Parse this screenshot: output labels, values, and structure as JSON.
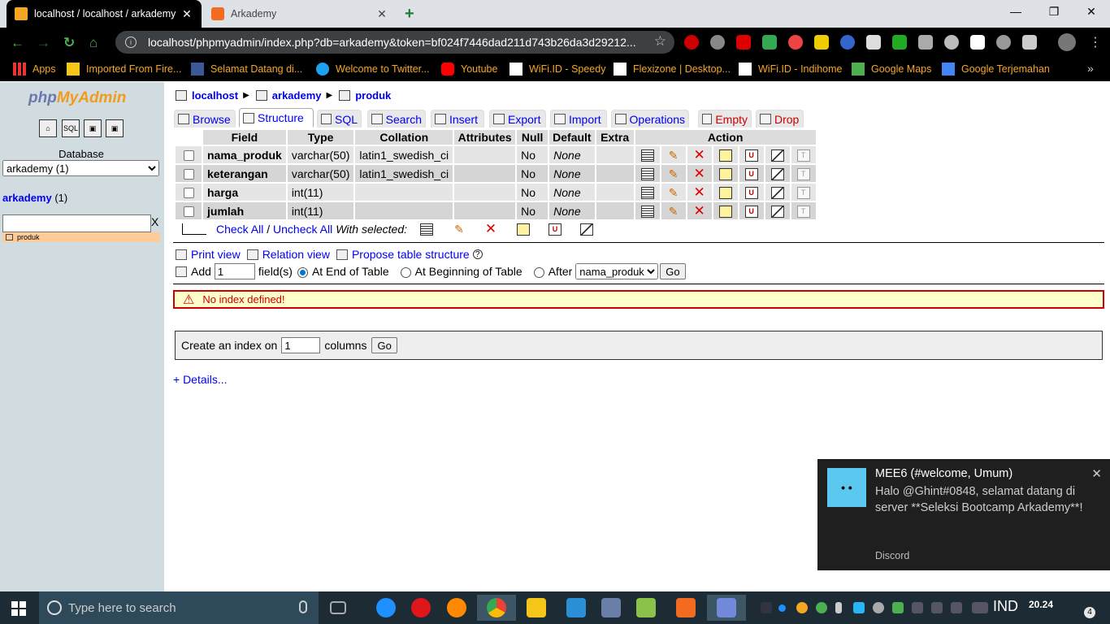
{
  "browser": {
    "tabs": [
      {
        "title": "localhost / localhost / arkademy",
        "active": true
      },
      {
        "title": "Arkademy",
        "active": false
      }
    ],
    "url": "localhost/phpmyadmin/index.php?db=arkademy&token=bf024f7446dad211d743b26da3d29212...",
    "bookmarks": [
      {
        "label": "Apps",
        "icon": "apps-grid-icon"
      },
      {
        "label": "Imported From Fire...",
        "icon": "folder-icon"
      },
      {
        "label": "Selamat Datang di...",
        "icon": "facebook-icon"
      },
      {
        "label": "Welcome to Twitter...",
        "icon": "twitter-icon"
      },
      {
        "label": "Youtube",
        "icon": "youtube-icon"
      },
      {
        "label": "WiFi.ID - Speedy",
        "icon": "page-icon"
      },
      {
        "label": "Flexizone | Desktop...",
        "icon": "page-icon"
      },
      {
        "label": "WiFi.ID - Indihome",
        "icon": "page-icon"
      },
      {
        "label": "Google Maps",
        "icon": "maps-icon"
      },
      {
        "label": "Google Terjemahan",
        "icon": "translate-icon"
      }
    ],
    "extensions": [
      "adblock-icon",
      "gear-icon",
      "ext-red-icon",
      "google-icon",
      "shield-icon",
      "ext-yellow-icon",
      "block-icon",
      "s-icon",
      "shield-green-icon",
      "shield-gray-icon",
      "globe-icon",
      "check-icon",
      "location-icon",
      "windows-icon",
      "avatar-icon"
    ]
  },
  "sidebar": {
    "logo_php": "php",
    "logo_myadmin": "MyAdmin",
    "database_label": "Database",
    "database_selected": "arkademy (1)",
    "db_link": "arkademy",
    "db_count": " (1)",
    "filter_clear": "X",
    "table_item": "produk"
  },
  "breadcrumb": {
    "server": "localhost",
    "database": "arkademy",
    "table": "produk"
  },
  "tabs": [
    {
      "label": "Browse",
      "icon": "browse-icon"
    },
    {
      "label": "Structure",
      "icon": "structure-icon"
    },
    {
      "label": "SQL",
      "icon": "sql-icon"
    },
    {
      "label": "Search",
      "icon": "search-icon"
    },
    {
      "label": "Insert",
      "icon": "insert-icon"
    },
    {
      "label": "Export",
      "icon": "export-icon"
    },
    {
      "label": "Import",
      "icon": "import-icon"
    },
    {
      "label": "Operations",
      "icon": "operations-icon"
    },
    {
      "label": "Empty",
      "icon": "empty-icon"
    },
    {
      "label": "Drop",
      "icon": "drop-icon"
    }
  ],
  "table": {
    "headers": [
      "Field",
      "Type",
      "Collation",
      "Attributes",
      "Null",
      "Default",
      "Extra",
      "Action"
    ],
    "rows": [
      {
        "field": "nama_produk",
        "type": "varchar(50)",
        "collation": "latin1_swedish_ci",
        "attributes": "",
        "null": "No",
        "default": "None",
        "extra": ""
      },
      {
        "field": "keterangan",
        "type": "varchar(50)",
        "collation": "latin1_swedish_ci",
        "attributes": "",
        "null": "No",
        "default": "None",
        "extra": ""
      },
      {
        "field": "harga",
        "type": "int(11)",
        "collation": "",
        "attributes": "",
        "null": "No",
        "default": "None",
        "extra": ""
      },
      {
        "field": "jumlah",
        "type": "int(11)",
        "collation": "",
        "attributes": "",
        "null": "No",
        "default": "None",
        "extra": ""
      }
    ],
    "check_all": "Check All",
    "slash": " / ",
    "uncheck_all": "Uncheck All",
    "with_selected": "With selected:"
  },
  "links": {
    "print_view": "Print view",
    "relation_view": "Relation view",
    "propose": "Propose table structure"
  },
  "add_field": {
    "add_label": "Add",
    "count": "1",
    "fields_label": "field(s)",
    "end_label": "At End of Table",
    "begin_label": "At Beginning of Table",
    "after_label": "After",
    "after_selected": "nama_produk",
    "go": "Go"
  },
  "notice": "No index defined!",
  "index": {
    "prefix": "Create an index on",
    "count": "1",
    "suffix": "columns",
    "go": "Go"
  },
  "details": "+ Details...",
  "toast": {
    "title": "MEE6 (#welcome, Umum)",
    "body": "Halo @Ghint#0848, selamat datang di server **Seleksi Bootcamp Arkademy**!",
    "app": "Discord"
  },
  "taskbar": {
    "search_placeholder": "Type here to search",
    "lang": "IND",
    "time": "20.24",
    "notifications": "4"
  }
}
